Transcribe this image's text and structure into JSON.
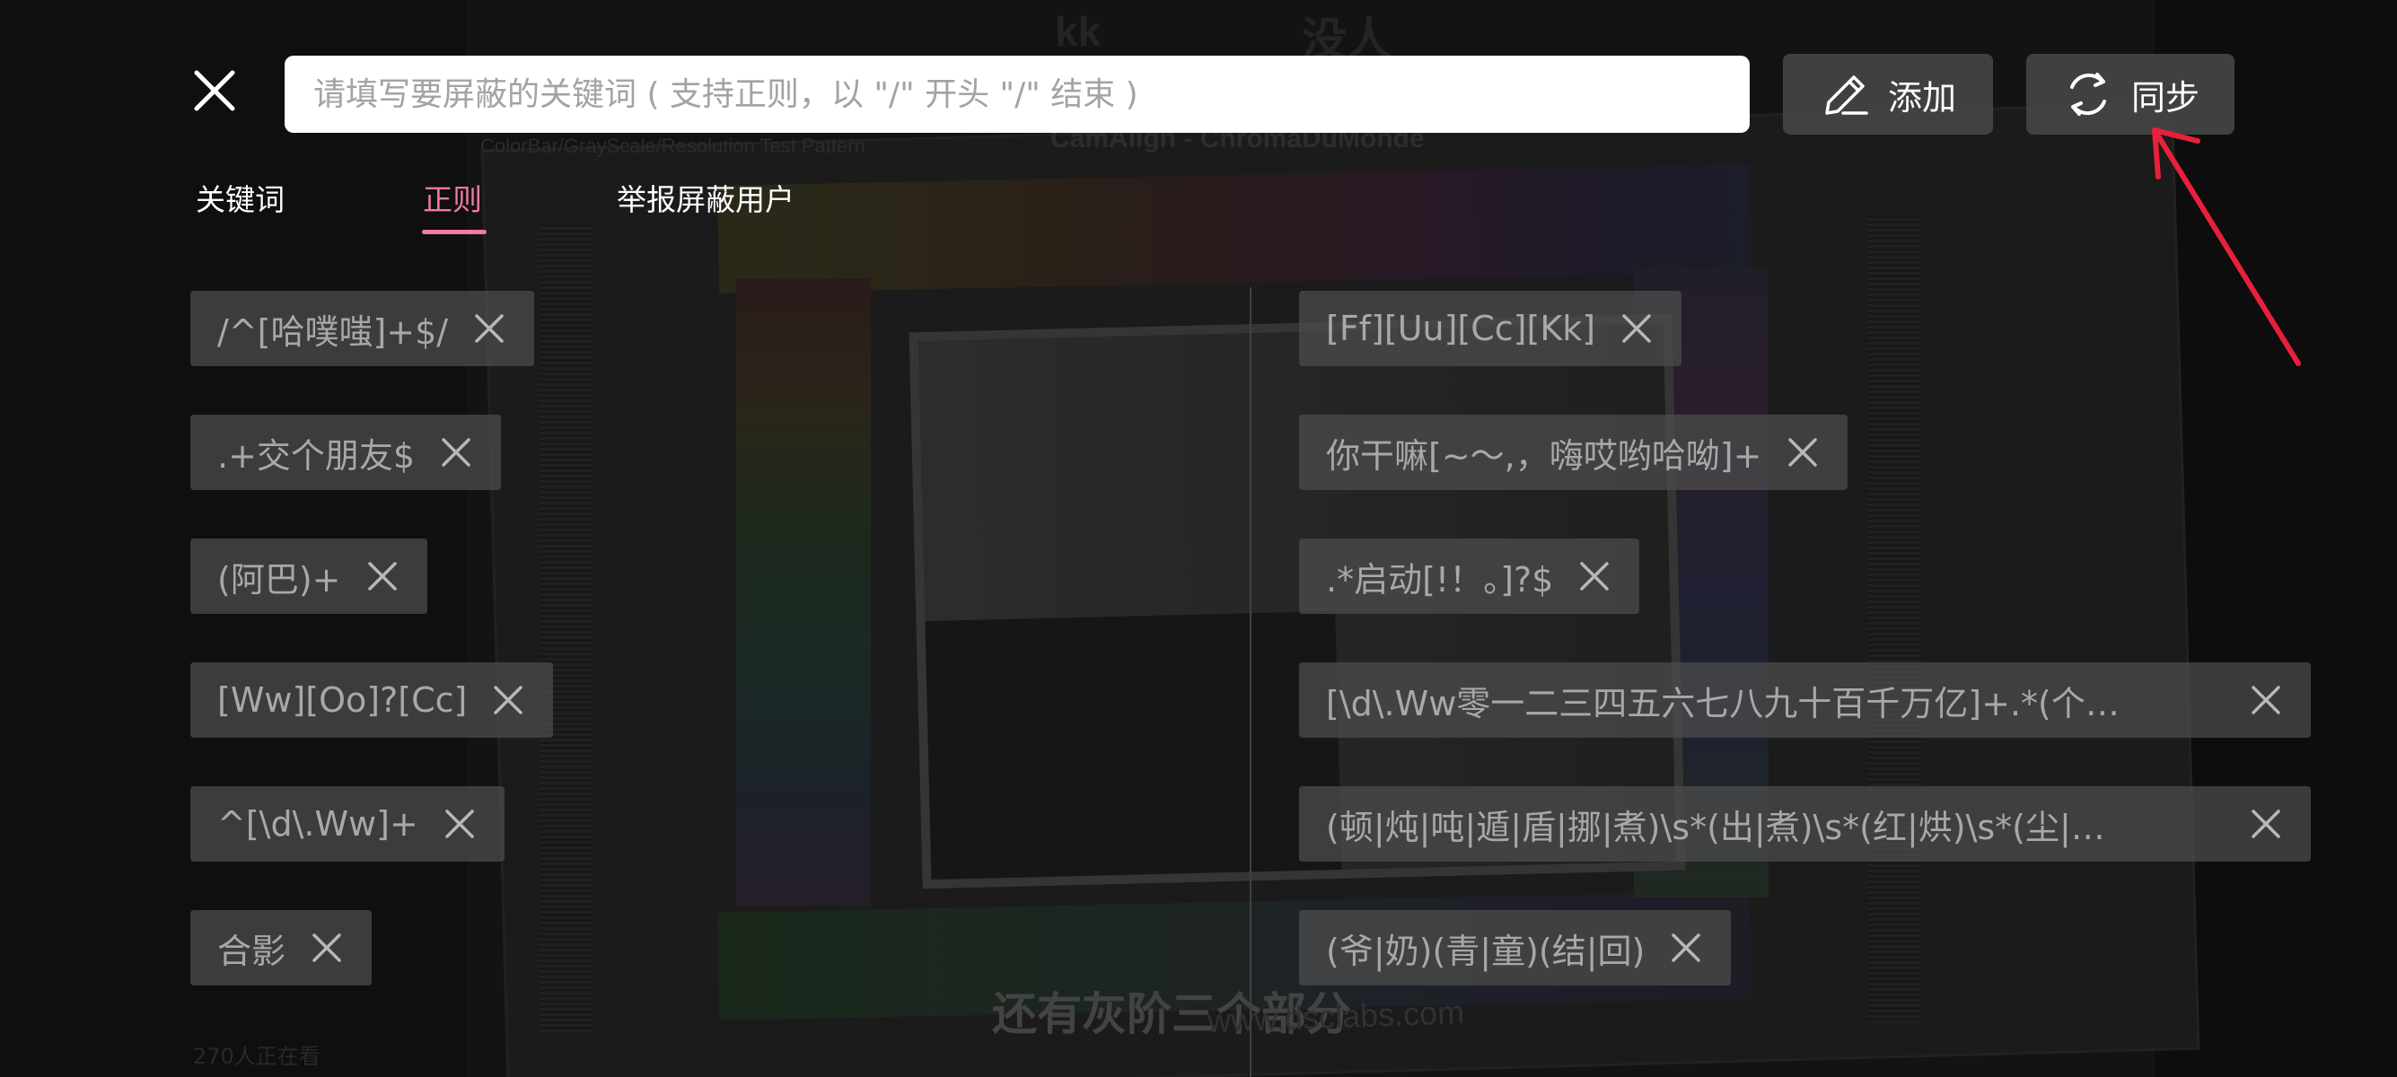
{
  "background_video": {
    "top_text_1": "kk",
    "top_text_2": "没人",
    "chart_title": "CamAlign - ChromaDuMonde",
    "chart_caption": "ColorBar/GrayScale/Resolution Test Pattern",
    "subtitle": "还有灰阶三个部分",
    "url": "www.dsclabs.com",
    "viewers": "270人正在看"
  },
  "search": {
    "placeholder": "请填写要屏蔽的关键词 ( 支持正则，以 \"/\" 开头 \"/\" 结束 )",
    "value": ""
  },
  "toolbar": {
    "add_label": "添加",
    "sync_label": "同步"
  },
  "tabs": [
    {
      "label": "关键词",
      "active": false
    },
    {
      "label": "正则",
      "active": true
    },
    {
      "label": "举报屏蔽用户",
      "active": false
    }
  ],
  "rules_left": [
    "/^[哈噗嗤]+$/",
    ".+交个朋友$",
    "(阿巴)+",
    "[Ww][Oo]?[Cc]",
    "^[\\d\\.Ww]+",
    "合影"
  ],
  "rules_right": [
    "[Ff][Uu][Cc][Kk]",
    "你干嘛[~～,，嗨哎哟哈呦]+",
    ".*启动[!！。]?$",
    "[\\d\\.Ww零一二三四五六七八九十百千万亿]+.*(个…",
    "(顿|炖|吨|遁|盾|挪|煮)\\s*(出|煮)\\s*(红|烘)\\s*(尘|…",
    "(爷|奶)(青|童)(结|回)"
  ],
  "colors": {
    "accent": "#f07aa0",
    "annotation": "#e8203a",
    "chip_bg": "#4e4e4e",
    "chip_text": "#a8a8a8"
  },
  "icons": {
    "close": "close-icon",
    "add": "pencil-icon",
    "sync": "sync-icon",
    "chip_remove": "remove-x-icon"
  }
}
